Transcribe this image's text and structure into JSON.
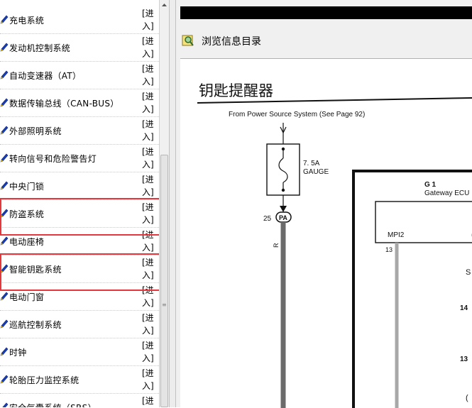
{
  "sidebar": {
    "enter_label": "[进入]",
    "items": [
      {
        "label": "充电系统"
      },
      {
        "label": "发动机控制系统"
      },
      {
        "label": "自动变速器（AT）"
      },
      {
        "label": "数据传输总线（CAN-BUS）"
      },
      {
        "label": "外部照明系统"
      },
      {
        "label": "转向信号和危险警告灯"
      },
      {
        "label": "中央门锁"
      },
      {
        "label": "防盗系统"
      },
      {
        "label": "电动座椅"
      },
      {
        "label": "智能钥匙系统"
      },
      {
        "label": "电动门窗"
      },
      {
        "label": "巡航控制系统"
      },
      {
        "label": "时钟"
      },
      {
        "label": "轮胎压力监控系统"
      },
      {
        "label": "安全气囊系统（SRS）"
      }
    ],
    "highlighted": [
      "防盗系统",
      "智能钥匙系统"
    ]
  },
  "toolbar": {
    "browse_label": "浏览信息目录"
  },
  "diagram": {
    "title": "钥匙提醒器",
    "source_note": "From Power Source System (See Page 92)",
    "fuse_rating": "7. 5A",
    "fuse_name": "GAUGE",
    "connector_pin": "25",
    "connector_name": "PA",
    "wire_color": "R",
    "ecu_id": "G 1",
    "ecu_name": "Gateway ECU",
    "ecu_port": "MPI2",
    "ecu_pin_1": "13",
    "pin_14": "14",
    "pin_13": "13",
    "edge_fragment_1": "(",
    "edge_fragment_2": "S",
    "edge_fragment_3": "("
  },
  "colors": {
    "highlight_border": "#e4393c",
    "pen_icon": "#1a3fb5",
    "wire": "#6b6b6b"
  }
}
